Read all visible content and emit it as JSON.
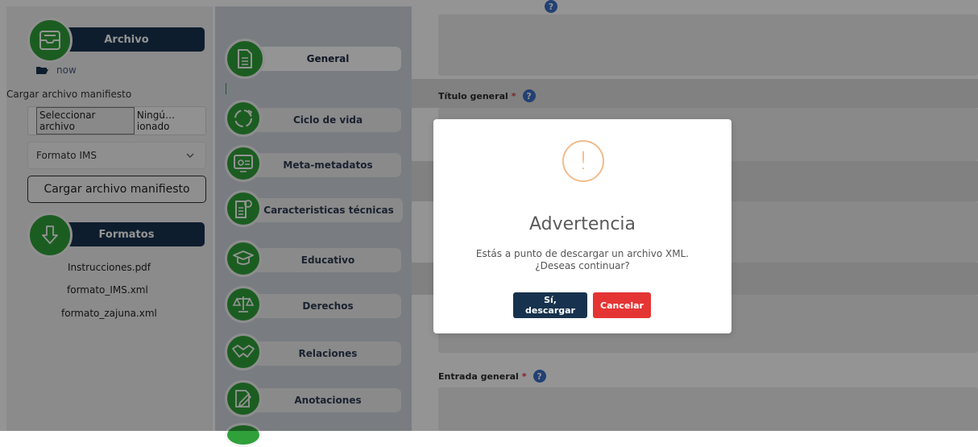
{
  "sidebar": {
    "archivo": {
      "title": "Archivo",
      "icon": "inbox-tray-icon"
    },
    "folder": {
      "label": "now",
      "icon": "folder-open-icon"
    },
    "upload_label": "Cargar archivo manifiesto",
    "file_input": {
      "button_label": "Seleccionar archivo",
      "status": "Ningú…ionado"
    },
    "format_select": {
      "value": "Formato IMS"
    },
    "load_button": "Cargar archivo manifiesto",
    "formatos": {
      "title": "Formatos",
      "icon": "arrow-down-icon",
      "links": [
        "Instrucciones.pdf",
        "formato_IMS.xml",
        "formato_zajuna.xml"
      ]
    }
  },
  "nav": {
    "items": [
      {
        "label": "General",
        "icon": "document-icon",
        "active": true
      },
      {
        "label": "Ciclo de vida",
        "icon": "cycle-icon"
      },
      {
        "label": "Meta-metadatos",
        "icon": "monitor-icon"
      },
      {
        "label": "Caracteristicas técnicas",
        "icon": "settings-document-icon"
      },
      {
        "label": "Educativo",
        "icon": "graduation-cap-icon"
      },
      {
        "label": "Derechos",
        "icon": "balance-scale-icon"
      },
      {
        "label": "Relaciones",
        "icon": "handshake-icon"
      },
      {
        "label": "Anotaciones",
        "icon": "note-edit-icon"
      }
    ]
  },
  "form": {
    "fields": [
      {
        "label": "Título general",
        "required": "*",
        "help": "?"
      },
      {
        "label": "Entrada general",
        "required": "*",
        "help": "?"
      }
    ]
  },
  "modal": {
    "icon": "warning-icon",
    "icon_glyph": "!",
    "title": "Advertencia",
    "message": "Estás a punto de descargar un archivo XML. ¿Deseas continuar?",
    "confirm_label": "Sí, descargar",
    "cancel_label": "Cancelar"
  },
  "colors": {
    "navy": "#17324e",
    "green": "#30a03a",
    "danger": "#e53434",
    "warning": "#f1bc8c",
    "help": "#3b6fc6"
  }
}
